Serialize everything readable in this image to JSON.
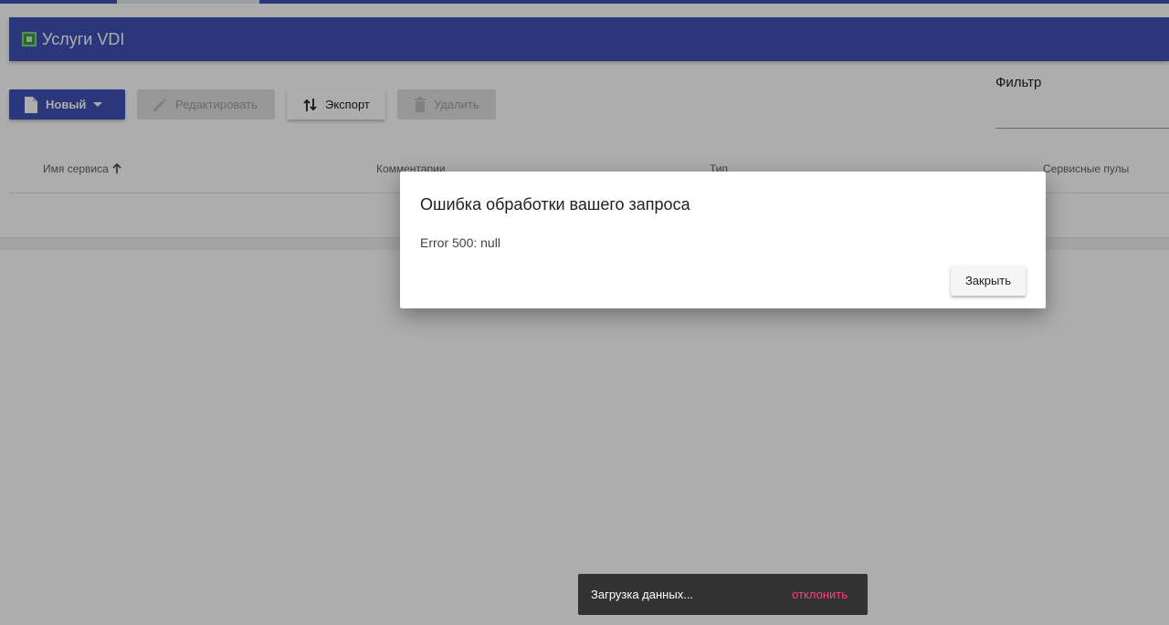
{
  "colors": {
    "primary": "#3f51b5",
    "accent": "#ff4081",
    "disabled": "#e0e0e0"
  },
  "header": {
    "title": "Услуги VDI",
    "icon": "vdi-chip-icon"
  },
  "toolbar": {
    "new_label": "Новый",
    "edit_label": "Редактировать",
    "export_label": "Экспорт",
    "delete_label": "Удалить"
  },
  "filter": {
    "label": "Фильтр",
    "value": ""
  },
  "table": {
    "columns": [
      {
        "label": "Имя сервиса",
        "sort": "ascending"
      },
      {
        "label": "Комментарии"
      },
      {
        "label": "Тип"
      },
      {
        "label": "Сервисные пулы"
      }
    ]
  },
  "dialog": {
    "title": "Ошибка обработки вашего запроса",
    "message": "Error 500: null",
    "close_label": "Закрыть"
  },
  "snackbar": {
    "message": "Загрузка данных...",
    "action": "отклонить"
  }
}
